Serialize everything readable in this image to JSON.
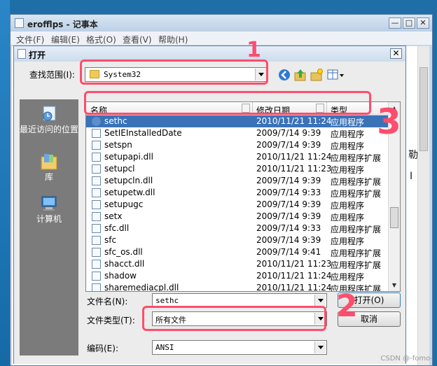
{
  "notepad": {
    "title": "erofflps - 记事本",
    "controls": {
      "minimize": "—",
      "maximize": "□",
      "close": "✕"
    },
    "menu": [
      "文件(F)",
      "编辑(E)",
      "格式(O)",
      "查看(V)",
      "帮助(H)"
    ],
    "text_fragments": [
      "勒",
      "I"
    ]
  },
  "dialog": {
    "title": "打开",
    "close": "✕",
    "look_in_label": "查找范围(I):",
    "look_in_value": "System32",
    "places": [
      {
        "label": "最近访问的位置",
        "icon": "recent-places-icon"
      },
      {
        "label": "库",
        "icon": "libraries-icon"
      },
      {
        "label": "计算机",
        "icon": "computer-icon"
      }
    ],
    "columns": {
      "name": "名称",
      "date": "修改日期",
      "type": "类型"
    },
    "files": [
      {
        "name": "sethc",
        "date": "2010/11/21 11:24",
        "type": "应用程序",
        "icon": "sethc-app-icon",
        "selected": true
      },
      {
        "name": "SetIEInstalledDate",
        "date": "2009/7/14 9:39",
        "type": "应用程序",
        "icon": "app-icon"
      },
      {
        "name": "setspn",
        "date": "2009/7/14 9:39",
        "type": "应用程序",
        "icon": "app-icon"
      },
      {
        "name": "setupapi.dll",
        "date": "2010/11/21 11:24",
        "type": "应用程序扩展",
        "icon": "dll-icon"
      },
      {
        "name": "setupcl",
        "date": "2010/11/21 11:23",
        "type": "应用程序",
        "icon": "app-icon"
      },
      {
        "name": "setupcln.dll",
        "date": "2009/7/14 9:39",
        "type": "应用程序扩展",
        "icon": "dll-icon"
      },
      {
        "name": "setupetw.dll",
        "date": "2009/7/14 9:33",
        "type": "应用程序扩展",
        "icon": "dll-icon"
      },
      {
        "name": "setupugc",
        "date": "2009/7/14 9:39",
        "type": "应用程序",
        "icon": "setup-app-icon"
      },
      {
        "name": "setx",
        "date": "2009/7/14 9:39",
        "type": "应用程序",
        "icon": "app-icon"
      },
      {
        "name": "sfc.dll",
        "date": "2009/7/14 9:33",
        "type": "应用程序扩展",
        "icon": "dll-icon"
      },
      {
        "name": "sfc",
        "date": "2009/7/14 9:39",
        "type": "应用程序",
        "icon": "app-icon"
      },
      {
        "name": "sfc_os.dll",
        "date": "2009/7/14 9:41",
        "type": "应用程序扩展",
        "icon": "dll-icon"
      },
      {
        "name": "shacct.dll",
        "date": "2010/11/21 11:23",
        "type": "应用程序扩展",
        "icon": "dll-icon"
      },
      {
        "name": "shadow",
        "date": "2010/11/21 11:24",
        "type": "应用程序",
        "icon": "app-icon"
      },
      {
        "name": "sharemediacpl.dll",
        "date": "2010/11/21 11:24",
        "type": "应用程序扩展",
        "icon": "dll-icon"
      }
    ],
    "filename_label": "文件名(N):",
    "filename_value": "sethc",
    "filetype_label": "文件类型(T):",
    "filetype_value": "所有文件",
    "encoding_label": "编码(E):",
    "encoding_value": "ANSI",
    "open_button": "打开(O)",
    "cancel_button": "取消"
  },
  "annotations": [
    "1",
    "2",
    "3"
  ],
  "annotation_color": "#ff4d6d",
  "selection_color": "#3a72b8",
  "watermark": "CSDN @-fomo-"
}
